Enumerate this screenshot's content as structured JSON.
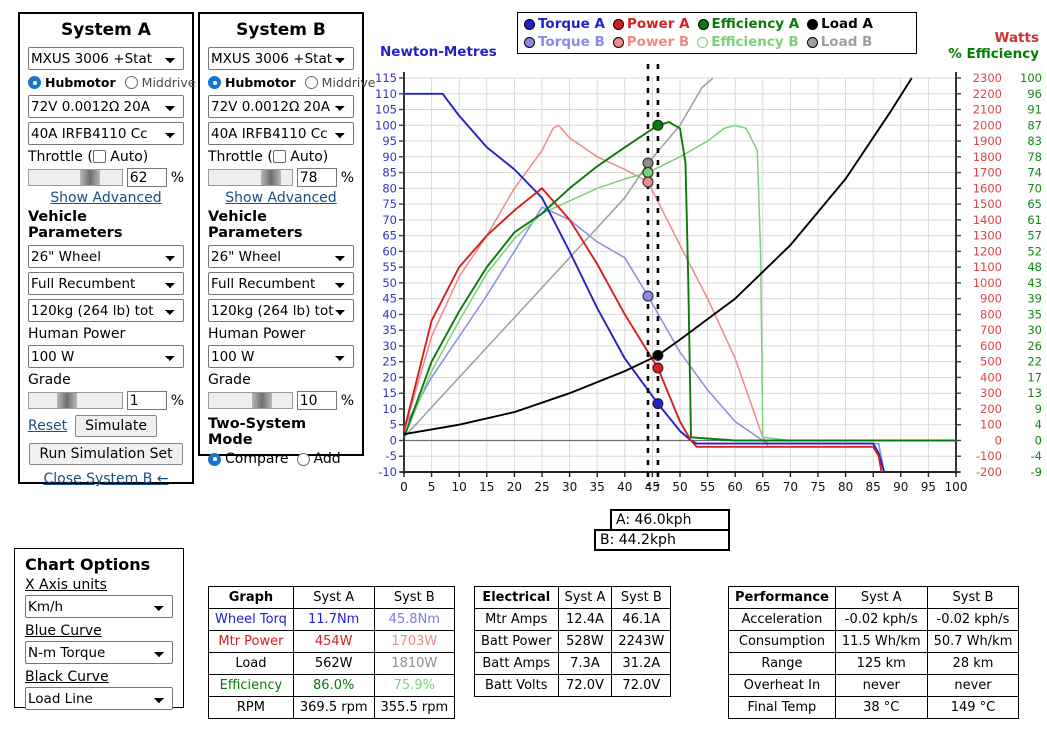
{
  "systemA": {
    "title": "System A",
    "motor": "MXUS 3006 +Stat",
    "drive_options": [
      {
        "label": "Hubmotor",
        "selected": true
      },
      {
        "label": "Middrive",
        "selected": false
      }
    ],
    "battery": "72V 0.0012Ω 20A",
    "controller": "40A IRFB4110 Cc",
    "throttle_label": "Throttle (",
    "throttle_auto_label": "Auto)",
    "throttle_value": "62",
    "throttle_pct": "%",
    "throttle_slider_pos": 62,
    "show_advanced": "Show Advanced",
    "vehicle_params_title": "Vehicle Parameters",
    "wheel": "26\"  Wheel",
    "body": "Full Recumbent",
    "weight": "120kg (264 lb) tot",
    "human_power_label": "Human Power",
    "human_power": "100 W",
    "grade_label": "Grade",
    "grade_value": "1",
    "grade_pct": "%",
    "grade_slider_pos": 35,
    "reset_label": "Reset",
    "simulate_label": "Simulate",
    "run_sim_set_label": "Run Simulation Set",
    "close_b_label": "Close System B ←"
  },
  "systemB": {
    "title": "System B",
    "motor": "MXUS 3006 +Stat",
    "drive_options": [
      {
        "label": "Hubmotor",
        "selected": true
      },
      {
        "label": "Middrive",
        "selected": false
      }
    ],
    "battery": "72V 0.0012Ω 20A",
    "controller": "40A IRFB4110 Cc",
    "throttle_label": "Throttle (",
    "throttle_auto_label": "Auto)",
    "throttle_value": "78",
    "throttle_pct": "%",
    "throttle_slider_pos": 78,
    "show_advanced": "Show Advanced",
    "vehicle_params_title": "Vehicle Parameters",
    "wheel": "26\"  Wheel",
    "body": "Full Recumbent",
    "weight": "120kg (264 lb) tot",
    "human_power_label": "Human Power",
    "human_power": "100 W",
    "grade_label": "Grade",
    "grade_value": "10",
    "grade_pct": "%",
    "grade_slider_pos": 58,
    "two_system_mode_title": "Two-System Mode",
    "mode_options": [
      {
        "label": "Compare",
        "selected": true
      },
      {
        "label": "Add",
        "selected": false
      }
    ]
  },
  "legend": {
    "row_a": [
      {
        "label": "Torque A",
        "color": "#2222cc",
        "filled": true
      },
      {
        "label": "Power A",
        "color": "#d62020",
        "filled": true
      },
      {
        "label": "Efficiency A",
        "color": "#0a7a0a",
        "filled": true
      },
      {
        "label": "Load A",
        "color": "#000000",
        "filled": true
      }
    ],
    "row_b": [
      {
        "label": "Torque B",
        "color": "#8a8ae8",
        "filled": true
      },
      {
        "label": "Power B",
        "color": "#ef8a8a",
        "filled": true
      },
      {
        "label": "Efficiency B",
        "color": "#7bd07b",
        "filled": false
      },
      {
        "label": "Load B",
        "color": "#9e9e9e",
        "filled": true
      }
    ]
  },
  "cursor": {
    "a_label": "A: 46.0kph",
    "b_label": "B: 44.2kph"
  },
  "chart_options": {
    "title": "Chart Options",
    "x_axis_label": "X Axis units",
    "x_axis_value": "Km/h",
    "blue_curve_label": "Blue Curve",
    "blue_curve_value": "N-m Torque",
    "black_curve_label": "Black Curve",
    "black_curve_value": "Load Line"
  },
  "tables": {
    "graph": {
      "headers": [
        "Graph",
        "Syst A",
        "Syst B"
      ],
      "rows": [
        {
          "label": "Wheel Torq",
          "a": "11.7Nm",
          "b": "45.8Nm",
          "cls": "blue"
        },
        {
          "label": "Mtr Power",
          "a": "454W",
          "b": "1703W",
          "cls": "red"
        },
        {
          "label": "Load",
          "a": "562W",
          "b": "1810W",
          "cls": "gray"
        },
        {
          "label": "Efficiency",
          "a": "86.0%",
          "b": "75.9%",
          "cls": "grn"
        },
        {
          "label": "RPM",
          "a": "369.5 rpm",
          "b": "355.5 rpm",
          "cls": "plain"
        }
      ]
    },
    "electrical": {
      "headers": [
        "Electrical",
        "Syst A",
        "Syst B"
      ],
      "rows": [
        {
          "label": "Mtr Amps",
          "a": "12.4A",
          "b": "46.1A"
        },
        {
          "label": "Batt Power",
          "a": "528W",
          "b": "2243W"
        },
        {
          "label": "Batt Amps",
          "a": "7.3A",
          "b": "31.2A"
        },
        {
          "label": "Batt Volts",
          "a": "72.0V",
          "b": "72.0V"
        }
      ]
    },
    "performance": {
      "headers": [
        "Performance",
        "Syst A",
        "Syst B"
      ],
      "rows": [
        {
          "label": "Acceleration",
          "a": "-0.02 kph/s",
          "b": "-0.02 kph/s"
        },
        {
          "label": "Consumption",
          "a": "11.5 Wh/km",
          "b": "50.7 Wh/km"
        },
        {
          "label": "Range",
          "a": "125 km",
          "b": "28 km"
        },
        {
          "label": "Overheat In",
          "a": "never",
          "b": "never"
        },
        {
          "label": "Final Temp",
          "a": "38 °C",
          "b": "149 °C"
        }
      ]
    }
  },
  "chart_data": {
    "type": "line",
    "title": "",
    "xlabel": "",
    "ylabel_left": "Newton-Metres",
    "ylabel_right_1": "Watts",
    "ylabel_right_2": "% Efficiency",
    "xlim": [
      0,
      100
    ],
    "ylim": [
      -10,
      115
    ],
    "xticks": [
      0,
      5,
      10,
      15,
      20,
      25,
      30,
      35,
      40,
      45,
      50,
      55,
      60,
      65,
      70,
      75,
      80,
      85,
      90,
      95,
      100
    ],
    "yticks_left": [
      -10,
      -5,
      0,
      5,
      10,
      15,
      20,
      25,
      30,
      35,
      40,
      45,
      50,
      55,
      60,
      65,
      70,
      75,
      80,
      85,
      90,
      95,
      100,
      105,
      110,
      115
    ],
    "yticks_right_watts": [
      -200,
      -100,
      0,
      100,
      200,
      300,
      400,
      500,
      600,
      700,
      800,
      900,
      1000,
      1100,
      1200,
      1300,
      1400,
      1500,
      1600,
      1700,
      1800,
      1900,
      2000,
      2100,
      2200,
      2300
    ],
    "yticks_right_eff": [
      -9,
      -4,
      0,
      4,
      9,
      13,
      17,
      22,
      26,
      30,
      35,
      39,
      43,
      48,
      52,
      57,
      61,
      65,
      70,
      74,
      78,
      83,
      87,
      91,
      96,
      100
    ],
    "grid": true,
    "legend_position": "top",
    "cursor_a_x": 46.0,
    "cursor_b_x": 44.2,
    "markers": [
      {
        "series": "Efficiency A",
        "x": 46.0,
        "y": 100,
        "color": "#0a7a0a"
      },
      {
        "series": "Load B",
        "x": 44.2,
        "y": 88,
        "color": "#8c8c8c"
      },
      {
        "series": "Efficiency B",
        "x": 44.2,
        "y": 85,
        "color": "#7bd07b"
      },
      {
        "series": "Power B",
        "x": 44.2,
        "y": 82,
        "color": "#ef8a8a"
      },
      {
        "series": "Torque B",
        "x": 44.2,
        "y": 45.8,
        "color": "#8a8ae8"
      },
      {
        "series": "Load A",
        "x": 46.0,
        "y": 27,
        "color": "#000000"
      },
      {
        "series": "Power A",
        "x": 46.0,
        "y": 23,
        "color": "#d62020"
      },
      {
        "series": "Torque A",
        "x": 46.0,
        "y": 11.7,
        "color": "#2222cc"
      }
    ],
    "series": [
      {
        "name": "Torque A",
        "color": "#2222cc",
        "points": [
          [
            0,
            110
          ],
          [
            5,
            110
          ],
          [
            7,
            110
          ],
          [
            10,
            103
          ],
          [
            15,
            93
          ],
          [
            20,
            86
          ],
          [
            25,
            77
          ],
          [
            30,
            60
          ],
          [
            35,
            42
          ],
          [
            40,
            26
          ],
          [
            46,
            11.7
          ],
          [
            50,
            3
          ],
          [
            52,
            0
          ],
          [
            53,
            -1
          ],
          [
            65,
            -1
          ],
          [
            85,
            -1
          ],
          [
            86,
            -4
          ],
          [
            87,
            -10
          ]
        ]
      },
      {
        "name": "Power A",
        "color": "#d62020",
        "points": [
          [
            0,
            3
          ],
          [
            5,
            38
          ],
          [
            10,
            55
          ],
          [
            15,
            65
          ],
          [
            20,
            73
          ],
          [
            25,
            80
          ],
          [
            30,
            70
          ],
          [
            35,
            56
          ],
          [
            40,
            40
          ],
          [
            46,
            23
          ],
          [
            50,
            6
          ],
          [
            52,
            0
          ],
          [
            53,
            -2
          ],
          [
            65,
            -2
          ],
          [
            85,
            -2
          ],
          [
            86,
            -5
          ],
          [
            86.5,
            -10
          ]
        ]
      },
      {
        "name": "Efficiency A",
        "color": "#0a7a0a",
        "points": [
          [
            0,
            1
          ],
          [
            5,
            25
          ],
          [
            10,
            41
          ],
          [
            15,
            55
          ],
          [
            20,
            66
          ],
          [
            25,
            72
          ],
          [
            30,
            80
          ],
          [
            35,
            87
          ],
          [
            40,
            93
          ],
          [
            46,
            100
          ],
          [
            48,
            101
          ],
          [
            50,
            99
          ],
          [
            51,
            88
          ],
          [
            51.5,
            50
          ],
          [
            52,
            1
          ],
          [
            60,
            0
          ],
          [
            80,
            0
          ],
          [
            100,
            0
          ]
        ]
      },
      {
        "name": "Load A",
        "color": "#000000",
        "points": [
          [
            0,
            2
          ],
          [
            10,
            5
          ],
          [
            20,
            9
          ],
          [
            30,
            15
          ],
          [
            40,
            22
          ],
          [
            46,
            27
          ],
          [
            50,
            32
          ],
          [
            60,
            45
          ],
          [
            70,
            62
          ],
          [
            80,
            83
          ],
          [
            88,
            104
          ],
          [
            92,
            115
          ]
        ]
      },
      {
        "name": "Torque B",
        "color": "#8a8ae8",
        "points": [
          [
            0,
            4
          ],
          [
            5,
            20
          ],
          [
            10,
            33
          ],
          [
            15,
            46
          ],
          [
            20,
            60
          ],
          [
            25,
            74
          ],
          [
            30,
            70
          ],
          [
            35,
            63
          ],
          [
            40,
            58
          ],
          [
            44.2,
            45.8
          ],
          [
            50,
            28
          ],
          [
            55,
            16
          ],
          [
            60,
            6
          ],
          [
            65,
            0
          ],
          [
            66,
            -1
          ],
          [
            80,
            -1
          ],
          [
            86,
            -1
          ],
          [
            87,
            -10
          ]
        ]
      },
      {
        "name": "Power B",
        "color": "#ef8a8a",
        "points": [
          [
            0,
            3
          ],
          [
            5,
            33
          ],
          [
            10,
            52
          ],
          [
            15,
            65
          ],
          [
            20,
            80
          ],
          [
            25,
            92
          ],
          [
            27,
            99
          ],
          [
            28,
            100
          ],
          [
            30,
            96
          ],
          [
            35,
            90
          ],
          [
            40,
            86
          ],
          [
            44.2,
            82
          ],
          [
            50,
            62
          ],
          [
            55,
            45
          ],
          [
            60,
            26
          ],
          [
            65,
            1
          ],
          [
            66,
            -2
          ],
          [
            80,
            -2
          ],
          [
            85,
            -2
          ],
          [
            86,
            -5
          ],
          [
            86.5,
            -10
          ]
        ]
      },
      {
        "name": "Efficiency B",
        "color": "#7bd07b",
        "points": [
          [
            0,
            1
          ],
          [
            5,
            22
          ],
          [
            10,
            38
          ],
          [
            15,
            53
          ],
          [
            20,
            64
          ],
          [
            25,
            72
          ],
          [
            30,
            76
          ],
          [
            35,
            80
          ],
          [
            40,
            83
          ],
          [
            44.2,
            85
          ],
          [
            50,
            90
          ],
          [
            55,
            95
          ],
          [
            58,
            99
          ],
          [
            60,
            100
          ],
          [
            62,
            99
          ],
          [
            64,
            92
          ],
          [
            64.6,
            60
          ],
          [
            65,
            1
          ],
          [
            70,
            0
          ],
          [
            85,
            0
          ],
          [
            100,
            0
          ]
        ]
      },
      {
        "name": "Load B",
        "color": "#9e9e9e",
        "points": [
          [
            0,
            1
          ],
          [
            10,
            20
          ],
          [
            20,
            39
          ],
          [
            30,
            58
          ],
          [
            40,
            77
          ],
          [
            44.2,
            88
          ],
          [
            50,
            100
          ],
          [
            54,
            112
          ],
          [
            56,
            115
          ]
        ]
      }
    ]
  }
}
